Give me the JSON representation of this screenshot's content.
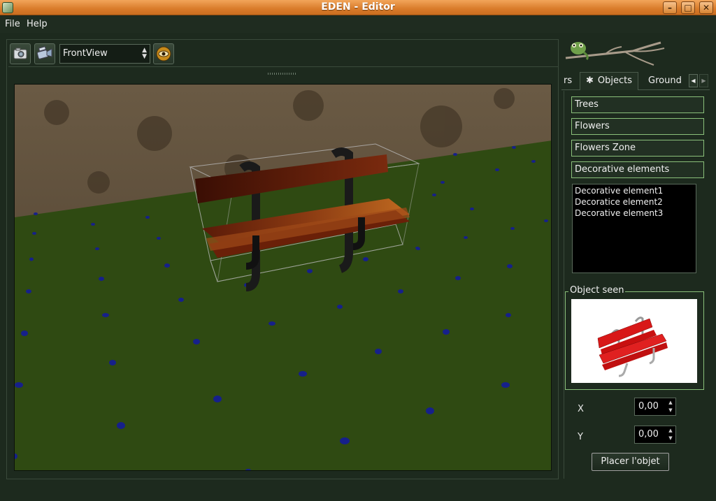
{
  "window": {
    "title": "EDEN - Editor",
    "controls": [
      "minimize",
      "maximize",
      "close"
    ]
  },
  "menu": {
    "items": [
      {
        "label": "File"
      },
      {
        "label": "Help"
      }
    ]
  },
  "toolbar": {
    "camera_icon": "camera-icon",
    "video_icon": "video-camera-icon",
    "view_select": {
      "value": "FrontView"
    },
    "eye_icon": "eye-icon"
  },
  "viewport": {
    "scene": "park-bench-on-grass",
    "ground_color": "#2f4a12",
    "sky_color": "#5b4a37"
  },
  "right_panel": {
    "tabs": [
      {
        "label": "rs"
      },
      {
        "label": "Objects",
        "active": true
      },
      {
        "label": "Ground"
      }
    ],
    "categories": [
      {
        "label": "Trees"
      },
      {
        "label": "Flowers"
      },
      {
        "label": "Flowers Zone"
      },
      {
        "label": "Decorative elements"
      }
    ],
    "list": [
      {
        "label": "Decorative element1"
      },
      {
        "label": "Decoratice element2"
      },
      {
        "label": "Decorative element3"
      }
    ],
    "object_seen": {
      "title": "Object seen"
    },
    "x": {
      "label": "X",
      "value": "0,00"
    },
    "y": {
      "label": "Y",
      "value": "0,00"
    },
    "place_button": "Placer l'objet"
  },
  "colors": {
    "titlebar": "#d97b2a",
    "background": "#1d2a1e",
    "accent_border": "#8ac07a"
  }
}
